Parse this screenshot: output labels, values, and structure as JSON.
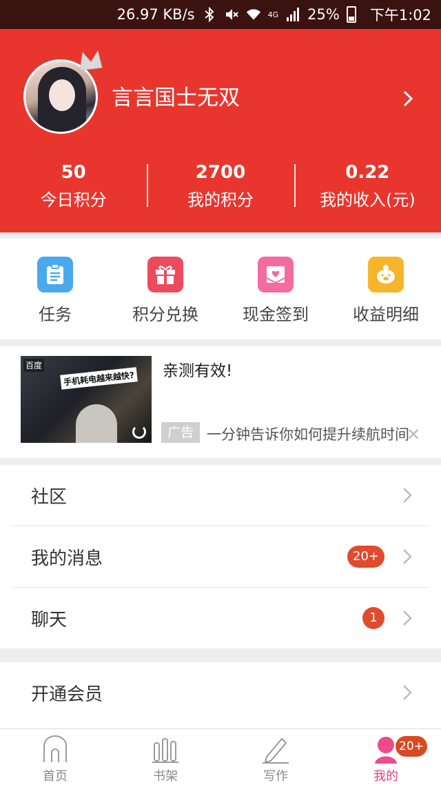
{
  "status_bar": {
    "speed": "26.97 KB/s",
    "network": "4G",
    "battery": "25%",
    "time": "下午1:02"
  },
  "profile": {
    "username": "言言国士无双",
    "stats": [
      {
        "value": "50",
        "label": "今日积分"
      },
      {
        "value": "2700",
        "label": "我的积分"
      },
      {
        "value": "0.22",
        "label": "我的收入(元)"
      }
    ]
  },
  "shortcuts": [
    {
      "label": "任务",
      "icon": "clipboard-icon",
      "color": "#4aa8ef"
    },
    {
      "label": "积分兑换",
      "icon": "gift-icon",
      "color": "#ec4b5d"
    },
    {
      "label": "现金签到",
      "icon": "envelope-heart-icon",
      "color": "#f36b9f"
    },
    {
      "label": "收益明细",
      "icon": "piggy-bank-icon",
      "color": "#f7b52c"
    }
  ],
  "ad": {
    "logo": "百度",
    "image_caption": "手机耗电越来越快?",
    "title": "亲测有效!",
    "badge": "广告",
    "description": "一分钟告诉你如何提升续航时间"
  },
  "menu": {
    "community": "社区",
    "messages": "我的消息",
    "messages_badge": "20+",
    "chat": "聊天",
    "chat_badge": "1",
    "vip": "开通会员"
  },
  "tabbar": {
    "home": "首页",
    "bookshelf": "书架",
    "write": "写作",
    "mine": "我的",
    "mine_badge": "20+"
  },
  "colors": {
    "brand_red": "#e8362e",
    "active_tab": "#e8407a"
  }
}
